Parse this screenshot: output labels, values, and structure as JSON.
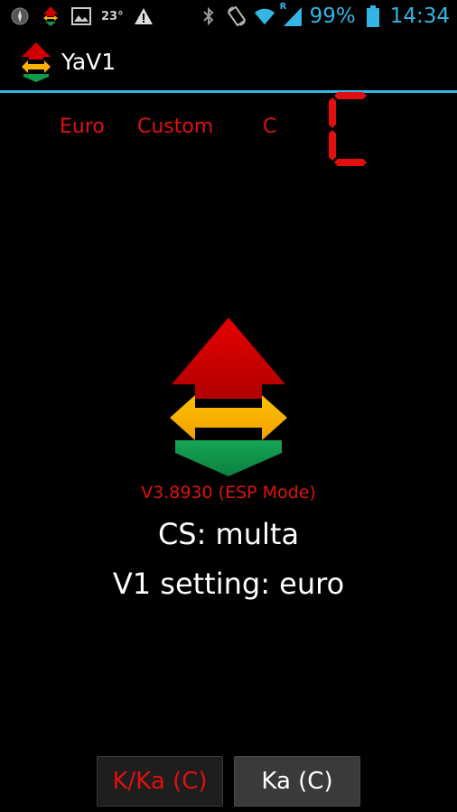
{
  "status_bar": {
    "temperature": "23°",
    "battery_percent": "99%",
    "time": "14:34",
    "signal_roaming": "R",
    "icons": [
      "compass-icon",
      "yav1-notification-icon",
      "image-icon",
      "temperature-text",
      "warning-icon",
      "bluetooth-icon",
      "rotation-icon",
      "wifi-icon",
      "signal-icon",
      "battery-icon"
    ]
  },
  "action_bar": {
    "title": "YaV1"
  },
  "modes": {
    "region": "Euro",
    "profile": "Custom",
    "mode_letter": "C",
    "segment_display": "C"
  },
  "main": {
    "version": "V3.8930 (ESP Mode)",
    "cs_line": "CS: multa",
    "v1_setting": "V1 setting: euro"
  },
  "buttons": {
    "k_ka": "K/Ka (C)",
    "ka": "Ka (C)"
  },
  "colors": {
    "accent": "#33b5e5",
    "alert_red": "#e01010",
    "arrow_red": "#d10000",
    "arrow_yellow": "#ffb000",
    "arrow_green": "#0f9a4a"
  }
}
